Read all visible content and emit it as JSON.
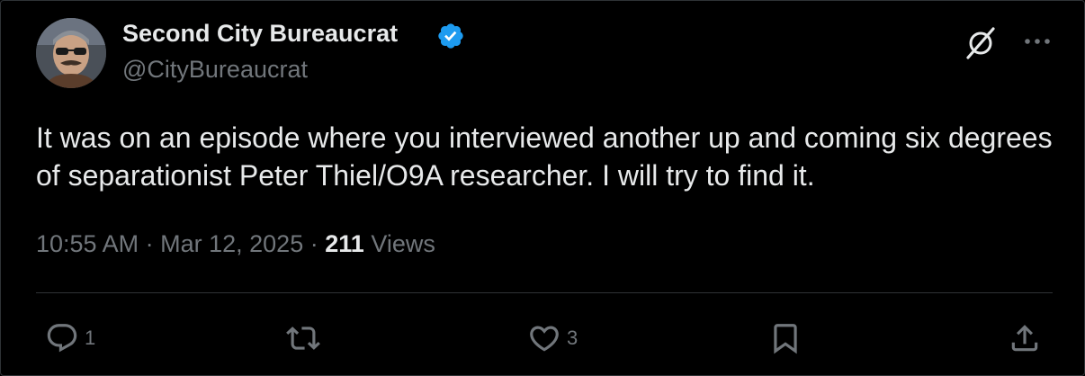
{
  "author": {
    "display_name": "Second City Bureaucrat",
    "handle": "@CityBureaucrat",
    "verified": true,
    "avatar_icon": "profile-photo-mustache-sunglasses"
  },
  "tweet": {
    "text": "It was on an episode where you interviewed another up and coming six degrees of separationist Peter Thiel/O9A researcher. I will try to find it.",
    "time": "10:55 AM",
    "date": "Mar 12, 2025",
    "separator": "·",
    "views_count": "211",
    "views_label": "Views"
  },
  "actions": {
    "reply_count": "1",
    "retweet_count": "",
    "like_count": "3"
  },
  "icons": {
    "top_right": [
      "grok-icon",
      "more-icon"
    ],
    "actions": [
      "reply-icon",
      "retweet-icon",
      "like-icon",
      "bookmark-icon",
      "share-icon"
    ]
  },
  "colors": {
    "background": "#000000",
    "text_primary": "#e7e9ea",
    "text_secondary": "#71767b",
    "divider": "#2f3336",
    "verified_blue": "#1d9bf0"
  }
}
